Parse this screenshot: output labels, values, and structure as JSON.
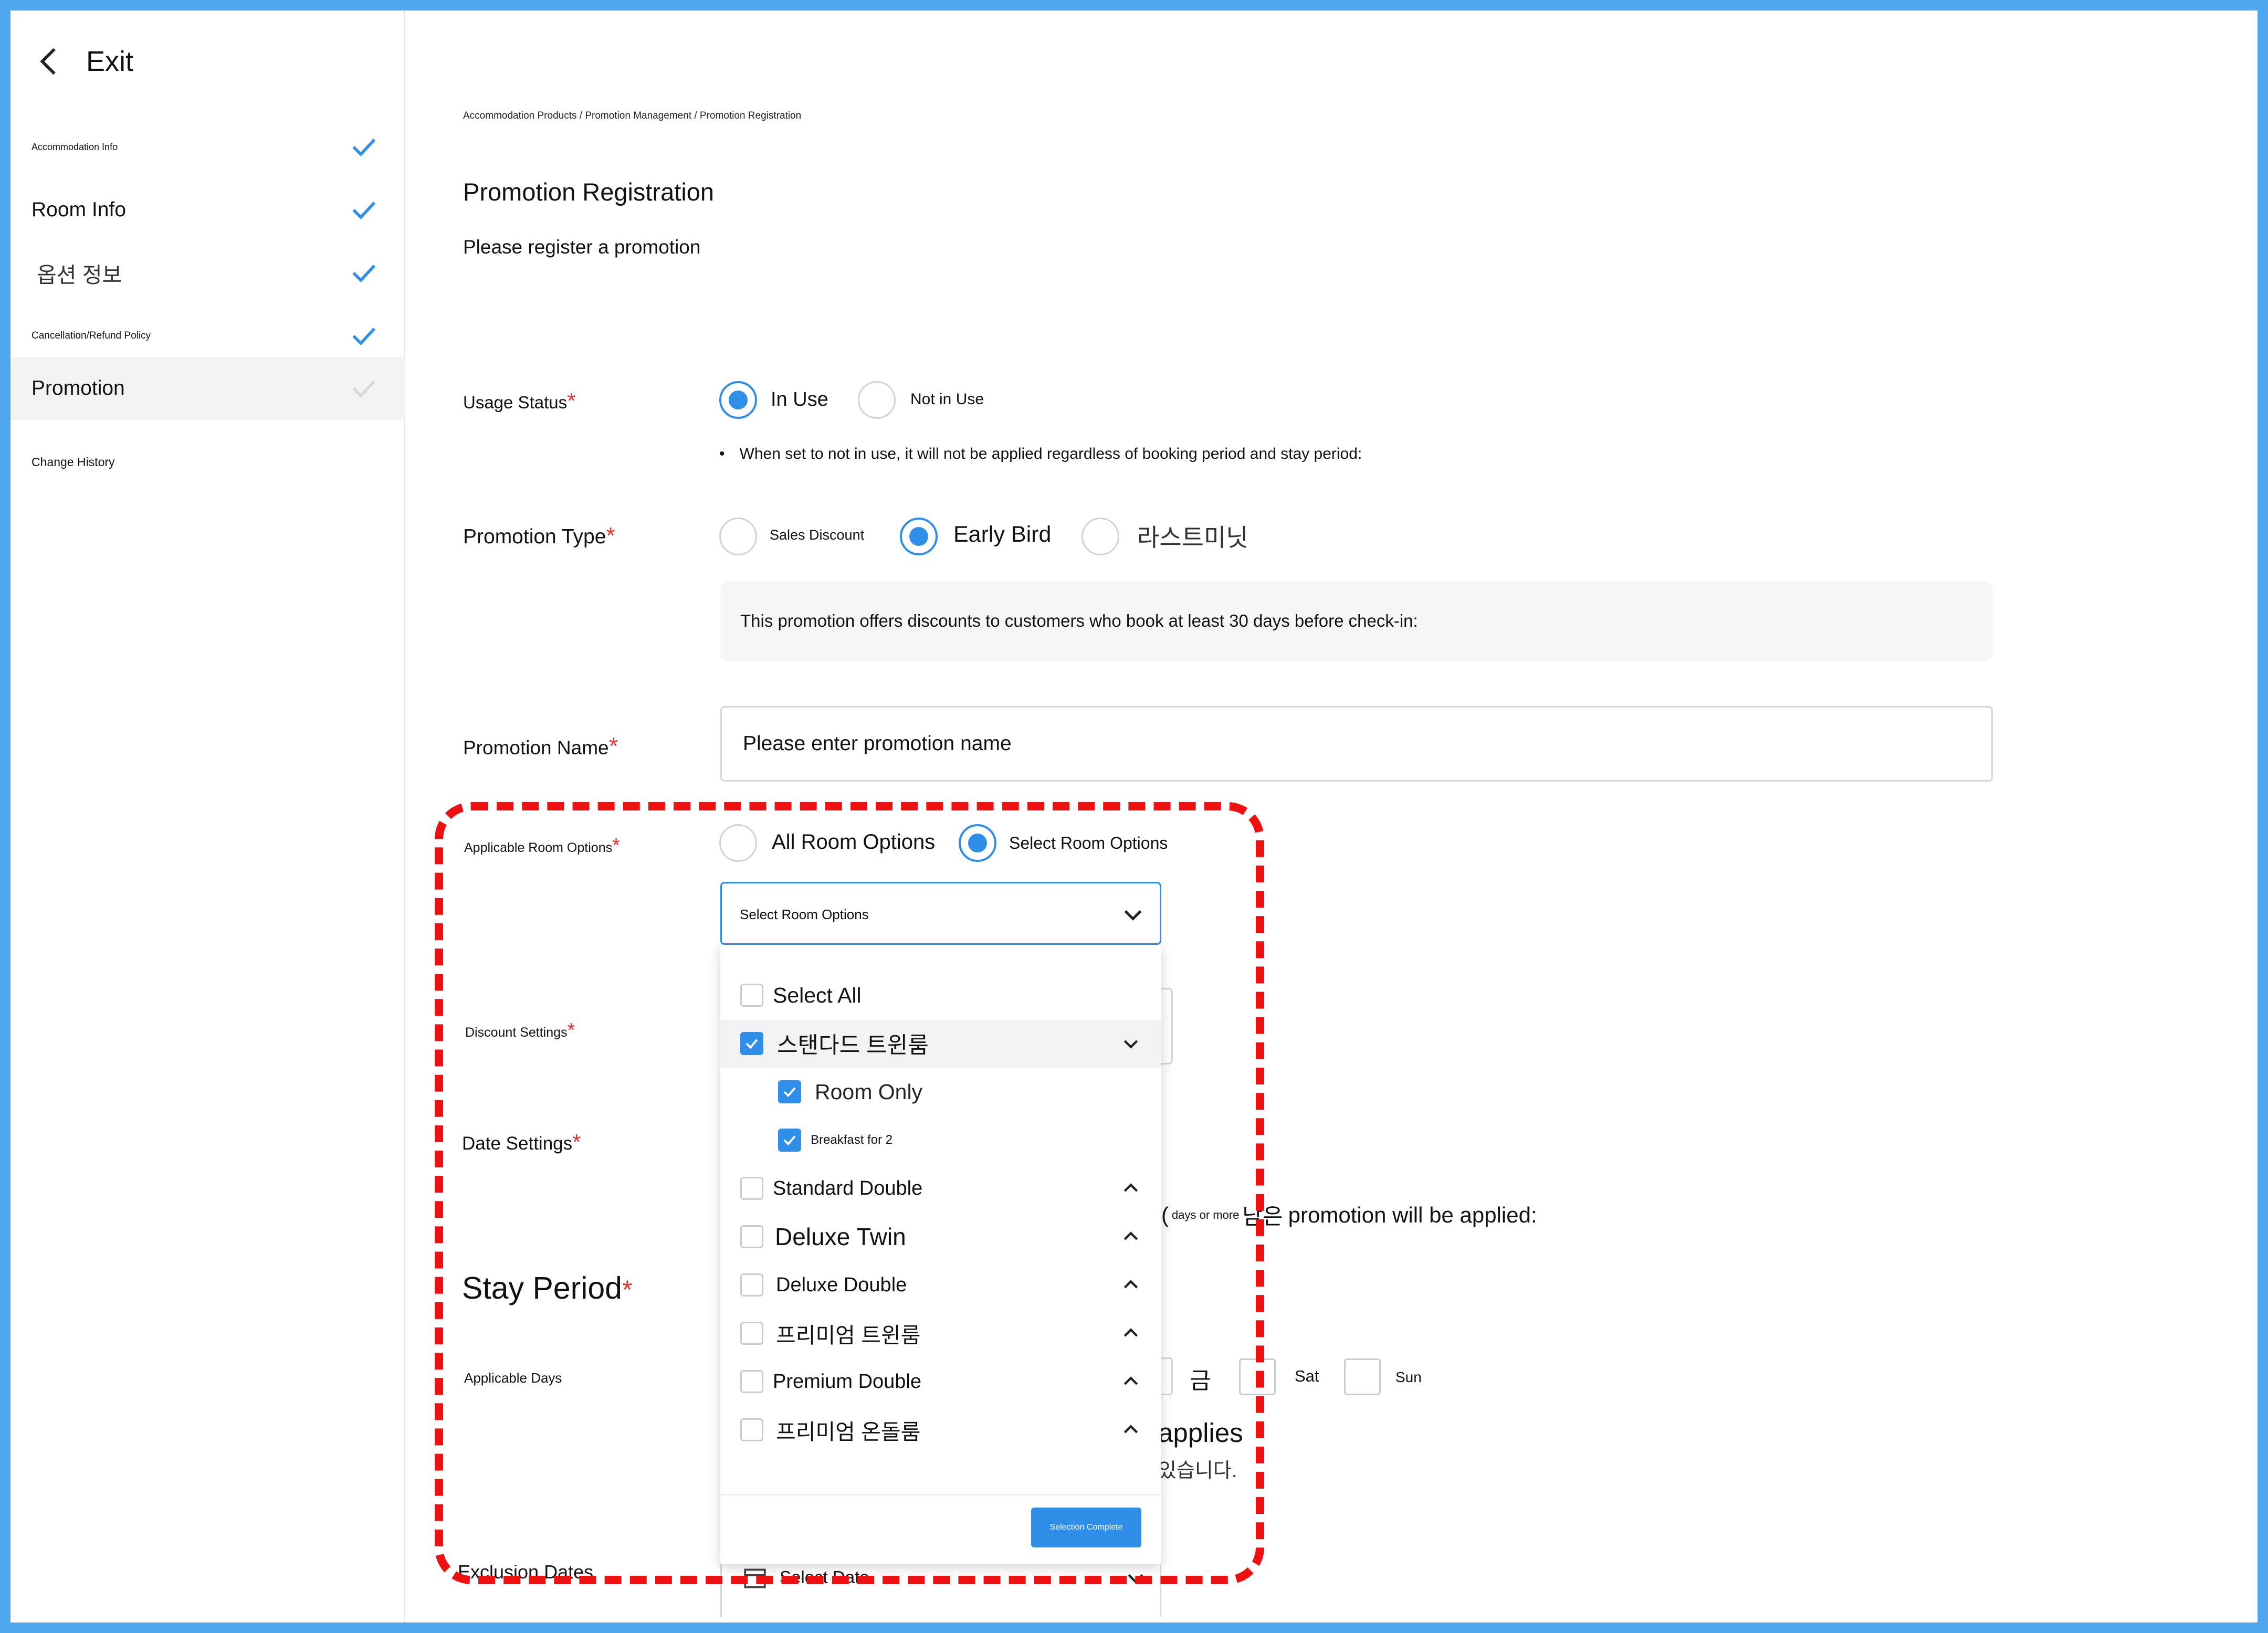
{
  "sidebar": {
    "exit_label": "Exit",
    "items": [
      {
        "label": "Accommodation Info"
      },
      {
        "label": "Room Info"
      },
      {
        "label": "옵션 정보"
      },
      {
        "label": "Cancellation/Refund Policy"
      },
      {
        "label": "Promotion"
      },
      {
        "label": "Change History"
      }
    ]
  },
  "breadcrumb": "Accommodation Products / Promotion Management / Promotion Registration",
  "page": {
    "title": "Promotion Registration",
    "subtitle": "Please register a promotion"
  },
  "usage_status": {
    "label": "Usage Status",
    "required_mark": "*",
    "options": [
      "In Use",
      "Not in Use"
    ],
    "selected": "In Use",
    "note": "When set to not in use, it will not be applied regardless of booking period and stay period:"
  },
  "promotion_type": {
    "label": "Promotion Type",
    "required_mark": "*",
    "options": [
      "Sales Discount",
      "Early Bird",
      "라스트미닛"
    ],
    "selected": "Early Bird",
    "description": "This promotion offers discounts to customers who book at least 30 days before check-in:"
  },
  "promotion_name": {
    "label": "Promotion Name",
    "required_mark": "*",
    "placeholder": "Please enter promotion name"
  },
  "room_options": {
    "label": "Applicable Room Options",
    "required_mark": "*",
    "options": [
      "All Room Options",
      "Select Room Options"
    ],
    "selected": "Select Room Options",
    "select_placeholder": "Select Room Options",
    "dropdown": {
      "select_all": "Select All",
      "groups": [
        {
          "name": "스탠다드 트윈룸",
          "checked": true,
          "expanded": true,
          "children": [
            {
              "name": "Room Only",
              "checked": true
            },
            {
              "name": "Breakfast for 2",
              "checked": true
            }
          ]
        },
        {
          "name": "Standard Double",
          "checked": false
        },
        {
          "name": "Deluxe Twin",
          "checked": false
        },
        {
          "name": "Deluxe Double",
          "checked": false
        },
        {
          "name": "프리미엄 트윈룸",
          "checked": false
        },
        {
          "name": "Premium Double",
          "checked": false
        },
        {
          "name": "프리미엄 온돌룸",
          "checked": false
        }
      ],
      "confirm_label": "Selection Complete"
    }
  },
  "discount_settings": {
    "label": "Discount Settings",
    "required_mark": "*"
  },
  "date_settings": {
    "label": "Date Settings",
    "required_mark": "*",
    "partial_text_1": "(",
    "days_badge": "days or more",
    "partial_text_2": "남은",
    "partial_text_3": "promotion will be applied:"
  },
  "stay_period": {
    "label": "Stay Period",
    "required_mark": "*"
  },
  "applicable_days": {
    "label": "Applicable Days",
    "visible_days": [
      "금",
      "Sat",
      "Sun"
    ],
    "partial_text_1": "applies",
    "partial_text_2": "있습니다."
  },
  "exclusion_dates": {
    "label": "Exclusion Dates",
    "placeholder": "Select Date"
  },
  "colors": {
    "accent": "#2f8fe8",
    "required": "#e8322b",
    "frame": "#4fa8ef",
    "annotation": "#ee1111"
  }
}
